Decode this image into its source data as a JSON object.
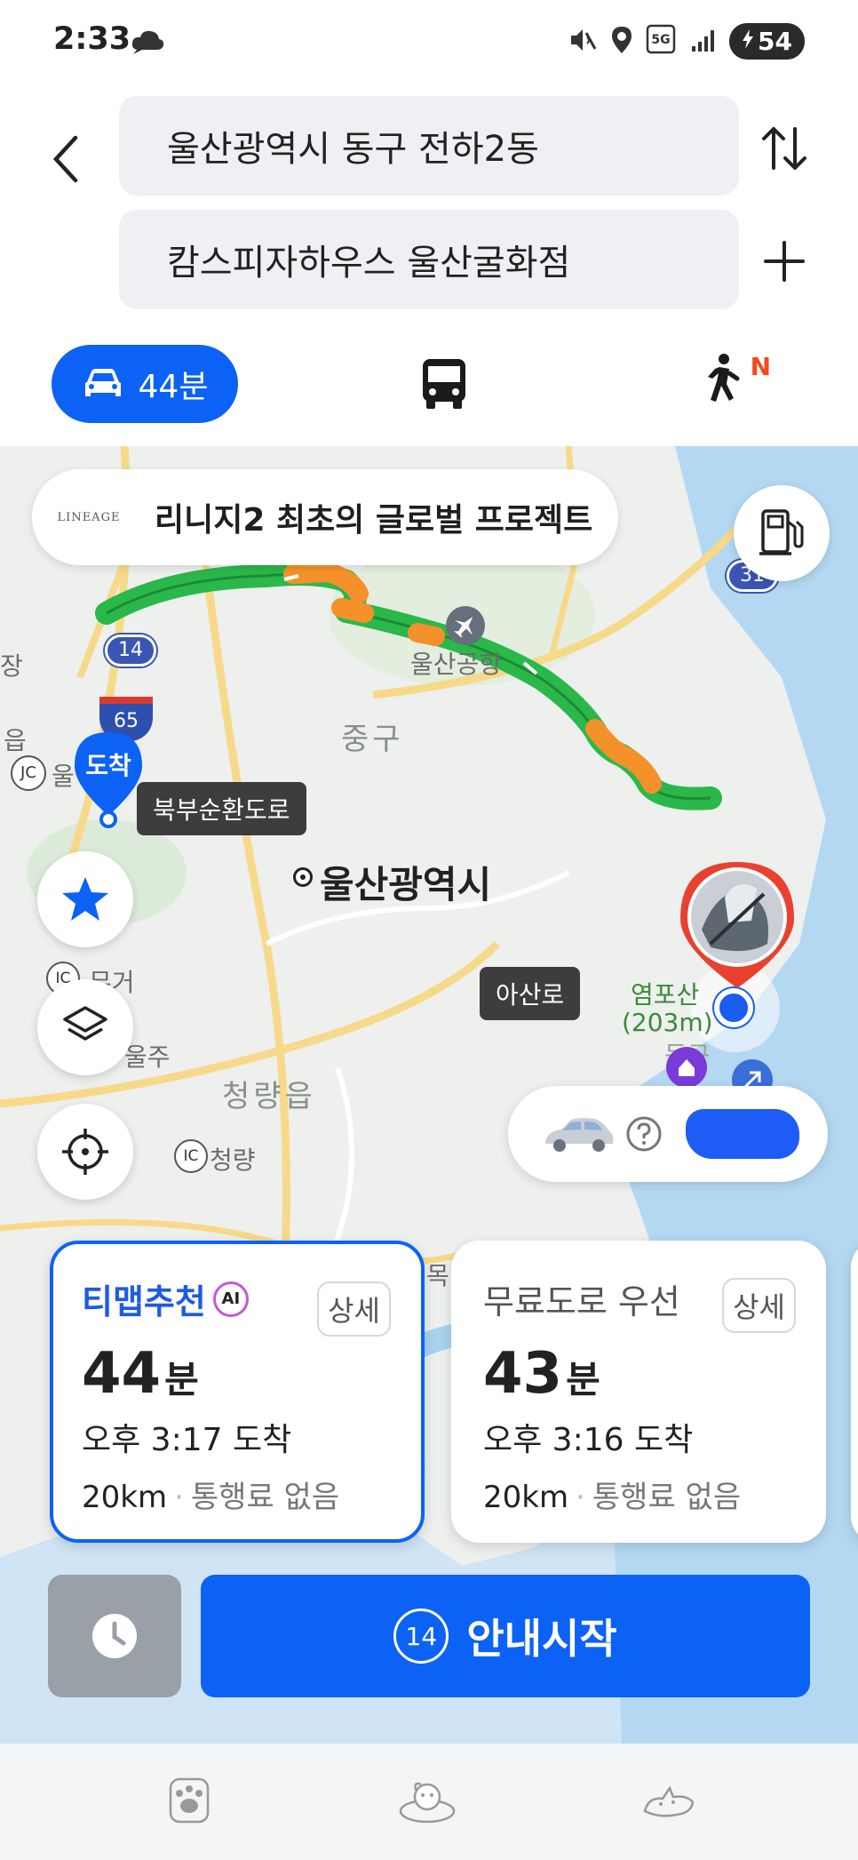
{
  "status_bar": {
    "time": "2:33",
    "network": "5G",
    "battery": "54"
  },
  "search": {
    "origin": "울산광역시 동구 전하2동",
    "destination": "캄스피자하우스 울산굴화점"
  },
  "modes": {
    "car_label": "44분",
    "walk_badge": "N"
  },
  "map": {
    "ad_logo": "LINEAGE",
    "ad_text": "리니지2 최초의 글로벌 프로젝트",
    "dest_pin_label": "도착",
    "road_tags": [
      "북부순환도로",
      "아산로"
    ],
    "labels": {
      "airport": "울산공항",
      "district_jung": "중구",
      "city": "울산광역시",
      "mountain": "염포산",
      "mountain_height": "(203m)",
      "mugeo": "무거",
      "ulju": "울주",
      "cheongnyang_eup": "청량읍",
      "cheongnyang": "청량",
      "eup": "읍",
      "ul": "울",
      "jang": "장",
      "mok": "목",
      "jc": "JC",
      "ic": "IC",
      "jung_right": "동구"
    },
    "route_shields": [
      "14",
      "65",
      "31"
    ]
  },
  "routes": [
    {
      "title": "티맵추천",
      "badge": "AI",
      "detail": "상세",
      "minutes": "44",
      "unit": "분",
      "arrival": "오후 3:17 도착",
      "distance": "20km",
      "toll": "통행료 없음"
    },
    {
      "title": "무료도로 우선",
      "detail": "상세",
      "minutes": "43",
      "unit": "분",
      "arrival": "오후 3:16 도착",
      "distance": "20km",
      "toll": "통행료 없음"
    }
  ],
  "actions": {
    "start_count": "14",
    "start_label": "안내시작"
  },
  "colors": {
    "accent": "#0c62f5",
    "route_green": "#2ab84a",
    "route_orange": "#f4912a",
    "pin_red": "#e84130"
  }
}
